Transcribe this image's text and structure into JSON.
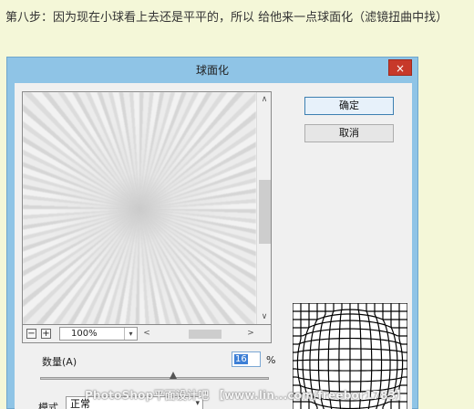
{
  "instruction": {
    "text": "第八步：因为现在小球看上去还是平平的，所以 给他来一点球面化（滤镜扭曲中找）"
  },
  "dialog": {
    "title": "球面化",
    "close_label": "×",
    "buttons": {
      "ok_label": "确定",
      "cancel_label": "取消"
    },
    "preview": {
      "zoom_out_label": "−",
      "zoom_in_label": "+",
      "zoom_value": "100%",
      "zoom_dropdown_glyph": "▾",
      "vscroll_up_glyph": "∧",
      "vscroll_down_glyph": "∨",
      "hscroll_left_glyph": "<",
      "hscroll_right_glyph": ">"
    },
    "amount": {
      "label": "数量(A)",
      "value": "16",
      "unit": "%",
      "fraction": 0.58
    },
    "mode": {
      "label": "模式",
      "value": "正常",
      "dropdown_glyph": "▾"
    }
  },
  "watermark": {
    "text": "PhotoShop平面设计吧 【www.lin...com/freebor1783】"
  },
  "colors": {
    "page_bg": "#f4f7d8",
    "dialog_frame": "#8fc4e6",
    "close_button": "#c7392a",
    "client_bg": "#f0f0f0"
  },
  "icons": {
    "close": "close-icon",
    "zoom_out": "zoom-out-icon",
    "zoom_in": "zoom-in-icon",
    "dropdown": "chevron-down-icon"
  }
}
